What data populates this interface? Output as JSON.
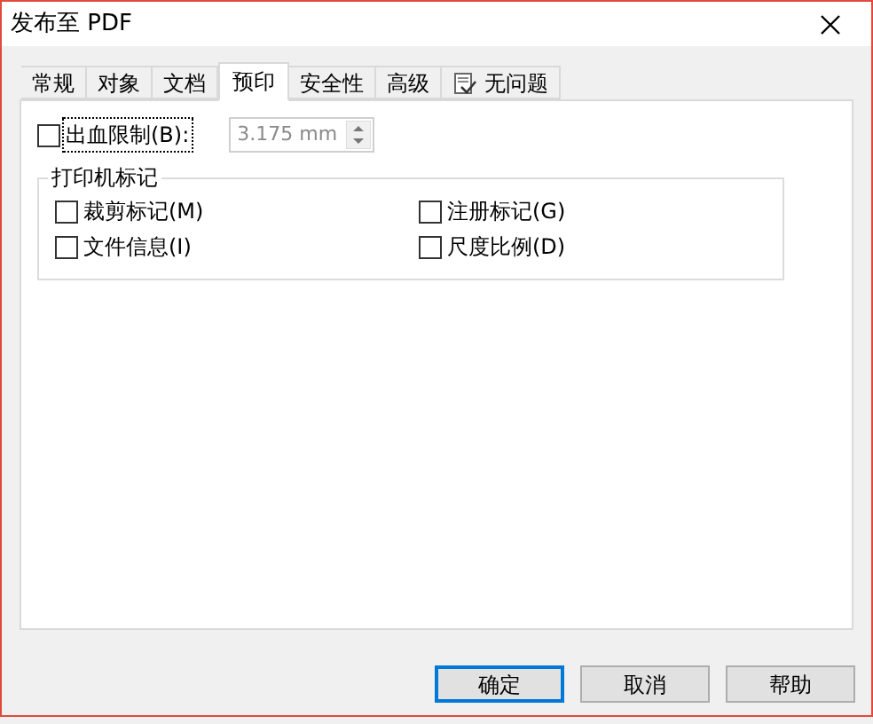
{
  "window": {
    "title": "发布至 PDF"
  },
  "tabs": [
    {
      "label": "常规",
      "selected": false
    },
    {
      "label": "对象",
      "selected": false
    },
    {
      "label": "文档",
      "selected": false
    },
    {
      "label": "预印",
      "selected": true
    },
    {
      "label": "安全性",
      "selected": false
    },
    {
      "label": "高级",
      "selected": false
    },
    {
      "label": "无问题",
      "selected": false,
      "kind": "status"
    }
  ],
  "bleed": {
    "label": "出血限制(B):",
    "checked": false,
    "value": "3.175 mm",
    "disabled": true
  },
  "printer_marks": {
    "title": "打印机标记",
    "options": [
      {
        "label": "裁剪标记(M)",
        "checked": false
      },
      {
        "label": "注册标记(G)",
        "checked": false
      },
      {
        "label": "文件信息(I)",
        "checked": false
      },
      {
        "label": "尺度比例(D)",
        "checked": false
      }
    ]
  },
  "buttons": [
    {
      "label": "确定",
      "default": true
    },
    {
      "label": "取消",
      "default": false
    },
    {
      "label": "帮助",
      "default": false
    }
  ]
}
